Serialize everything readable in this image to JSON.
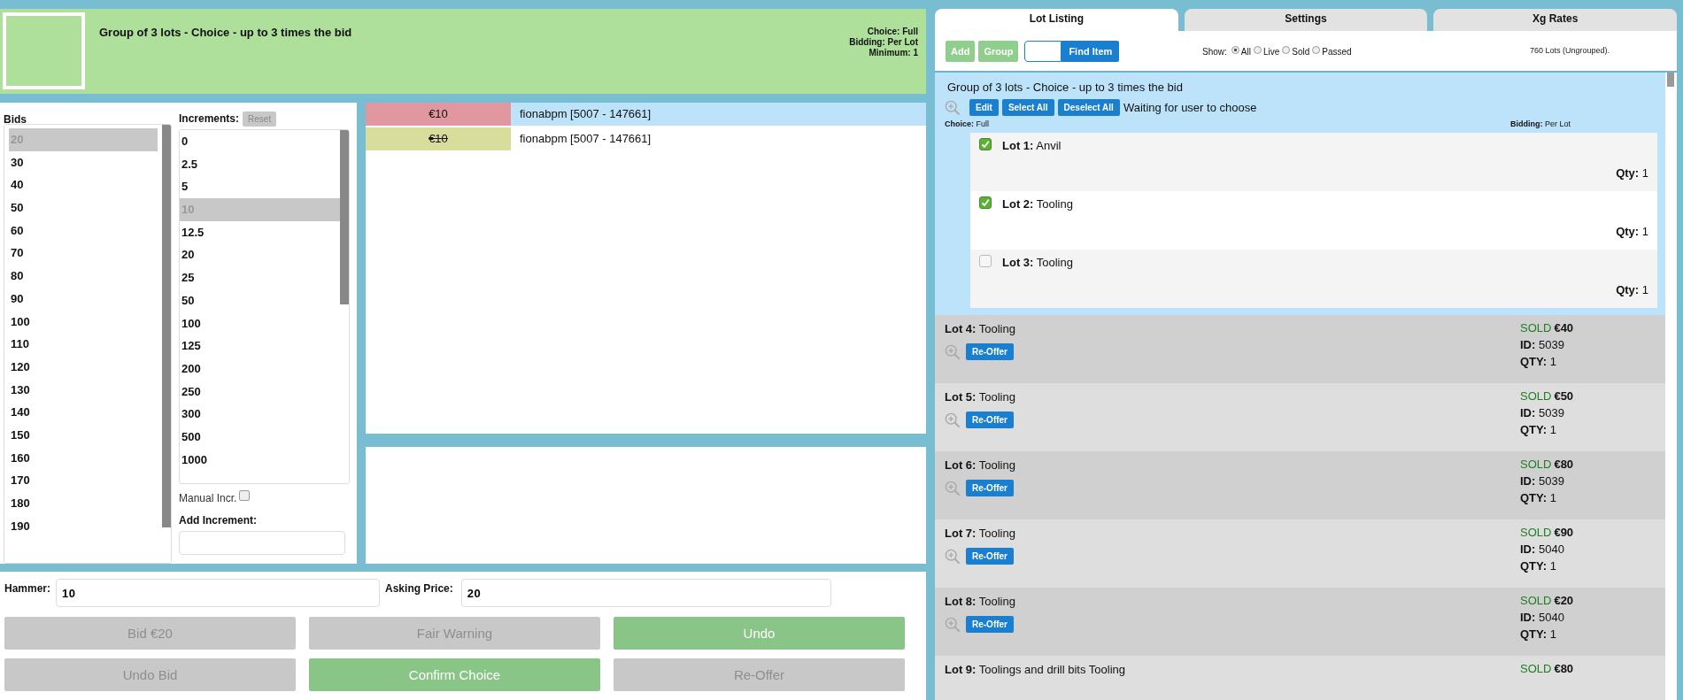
{
  "header": {
    "title": "Group of 3 lots - Choice - up to 3 times the bid",
    "meta": [
      "Choice: Full",
      "Bidding: Per Lot",
      "Minimum: 1"
    ]
  },
  "bids": {
    "heading": "Bids",
    "items": [
      {
        "value": "20",
        "selected": true
      },
      {
        "value": "30",
        "selected": false
      },
      {
        "value": "40",
        "selected": false
      },
      {
        "value": "50",
        "selected": false
      },
      {
        "value": "60",
        "selected": false
      },
      {
        "value": "70",
        "selected": false
      },
      {
        "value": "80",
        "selected": false
      },
      {
        "value": "90",
        "selected": false
      },
      {
        "value": "100",
        "selected": false
      },
      {
        "value": "110",
        "selected": false
      },
      {
        "value": "120",
        "selected": false
      },
      {
        "value": "130",
        "selected": false
      },
      {
        "value": "140",
        "selected": false
      },
      {
        "value": "150",
        "selected": false
      },
      {
        "value": "160",
        "selected": false
      },
      {
        "value": "170",
        "selected": false
      },
      {
        "value": "180",
        "selected": false
      },
      {
        "value": "190",
        "selected": false
      }
    ]
  },
  "increments": {
    "heading": "Increments:",
    "reset_button": "Reset",
    "items": [
      {
        "value": "0",
        "selected": false
      },
      {
        "value": "2.5",
        "selected": false
      },
      {
        "value": "5",
        "selected": false
      },
      {
        "value": "10",
        "selected": true
      },
      {
        "value": "12.5",
        "selected": false
      },
      {
        "value": "20",
        "selected": false
      },
      {
        "value": "25",
        "selected": false
      },
      {
        "value": "50",
        "selected": false
      },
      {
        "value": "100",
        "selected": false
      },
      {
        "value": "125",
        "selected": false
      },
      {
        "value": "200",
        "selected": false
      },
      {
        "value": "250",
        "selected": false
      },
      {
        "value": "300",
        "selected": false
      },
      {
        "value": "500",
        "selected": false
      },
      {
        "value": "1000",
        "selected": false
      }
    ],
    "manual_label": "Manual Incr.",
    "manual_checked": false,
    "add_label": "Add Increment:"
  },
  "bid_history": [
    {
      "amount": "€10",
      "bidder": "fionabpm [5007 - 147661]",
      "color": "#e0979f",
      "struck": false,
      "selected": true
    },
    {
      "amount": "€10",
      "bidder": "fionabpm [5007 - 147661]",
      "color": "#d9dd9b",
      "struck": true,
      "selected": false
    }
  ],
  "hammer": {
    "label": "Hammer:",
    "value": "10"
  },
  "asking_price": {
    "label": "Asking Price:",
    "value": "20"
  },
  "actions": [
    {
      "label": "Bid €20",
      "enabled": false
    },
    {
      "label": "Fair Warning",
      "enabled": false
    },
    {
      "label": "Undo",
      "enabled": true
    },
    {
      "label": "Undo Bid",
      "enabled": false
    },
    {
      "label": "Confirm Choice",
      "enabled": true
    },
    {
      "label": "Re-Offer",
      "enabled": false
    }
  ],
  "tabs": [
    {
      "label": "Lot Listing",
      "selected": true
    },
    {
      "label": "Settings",
      "selected": false
    },
    {
      "label": "Xg Rates",
      "selected": false
    }
  ],
  "toolbar": {
    "add_button": "Add",
    "group_button": "Group",
    "find_button": "Find Item",
    "show_label": "Show:",
    "filters": [
      {
        "label": "All",
        "selected": true
      },
      {
        "label": "Live",
        "selected": false
      },
      {
        "label": "Sold",
        "selected": false
      },
      {
        "label": "Passed",
        "selected": false
      }
    ],
    "count": "760 Lots (Ungrouped)."
  },
  "group": {
    "title": "Group of 3 lots - Choice - up to 3 times the bid",
    "buttons": [
      "Edit",
      "Select All",
      "Deselect All"
    ],
    "status": "Waiting for user to choose",
    "choice": "**Choice:** Full",
    "bidding": "**Bidding:** Per Lot",
    "lots": [
      {
        "title": "**Lot 1:** Anvil",
        "qty": "**Qty:** 1",
        "checked": true
      },
      {
        "title": "**Lot 2:** Tooling",
        "qty": "**Qty:** 1",
        "checked": true
      },
      {
        "title": "**Lot 3:** Tooling",
        "qty": "**Qty:** 1",
        "checked": false
      }
    ]
  },
  "lots": [
    {
      "title": "**Lot 4:** Tooling",
      "button": "Re-Offer",
      "status": "SOLD",
      "price": "€40",
      "id": "**ID:** 5039",
      "qty": "**QTY:** 1"
    },
    {
      "title": "**Lot 5:** Tooling",
      "button": "Re-Offer",
      "status": "SOLD",
      "price": "€50",
      "id": "**ID:** 5039",
      "qty": "**QTY:** 1"
    },
    {
      "title": "**Lot 6:** Tooling",
      "button": "Re-Offer",
      "status": "SOLD",
      "price": "€80",
      "id": "**ID:** 5039",
      "qty": "**QTY:** 1"
    },
    {
      "title": "**Lot 7:** Tooling",
      "button": "Re-Offer",
      "status": "SOLD",
      "price": "€90",
      "id": "**ID:** 5040",
      "qty": "**QTY:** 1"
    },
    {
      "title": "**Lot 8:** Tooling",
      "button": "Re-Offer",
      "status": "SOLD",
      "price": "€20",
      "id": "**ID:** 5040",
      "qty": "**QTY:** 1"
    },
    {
      "title": "**Lot 9:** Toolings and drill bits Tooling",
      "status": "SOLD",
      "price": "€80"
    }
  ]
}
